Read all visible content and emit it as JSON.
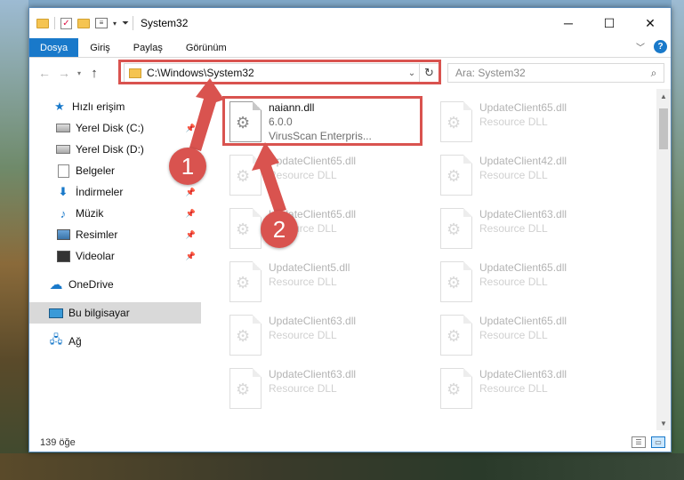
{
  "title": "System32",
  "ribbon": {
    "tabs": [
      "Dosya",
      "Giriş",
      "Paylaş",
      "Görünüm"
    ]
  },
  "address": {
    "path": "C:\\Windows\\System32",
    "search_placeholder": "Ara: System32"
  },
  "nav": {
    "items": [
      {
        "label": "Hızlı erişim",
        "icon": "star-icon"
      },
      {
        "label": "Yerel Disk (C:)",
        "icon": "drive-icon",
        "pinned": true
      },
      {
        "label": "Yerel Disk (D:)",
        "icon": "drive-icon",
        "pinned": true
      },
      {
        "label": "Belgeler",
        "icon": "documents-icon",
        "pinned": true
      },
      {
        "label": "İndirmeler",
        "icon": "downloads-icon",
        "pinned": true
      },
      {
        "label": "Müzik",
        "icon": "music-icon",
        "pinned": true
      },
      {
        "label": "Resimler",
        "icon": "pictures-icon",
        "pinned": true
      },
      {
        "label": "Videolar",
        "icon": "videos-icon",
        "pinned": true
      },
      {
        "label": "OneDrive",
        "icon": "cloud-icon"
      },
      {
        "label": "Bu bilgisayar",
        "icon": "computer-icon",
        "selected": true
      },
      {
        "label": "Ağ",
        "icon": "network-icon"
      }
    ]
  },
  "files": [
    {
      "name": "naiann.dll",
      "line1": "6.0.0",
      "line2": "VirusScan Enterpris...",
      "highlighted": true
    },
    {
      "name": "UpdateClient65.dll",
      "line1": "Resource DLL"
    },
    {
      "name": "UpdateClient65.dll",
      "line1": "Resource DLL"
    },
    {
      "name": "UpdateClient42.dll",
      "line1": "Resource DLL"
    },
    {
      "name": "UpdateClient65.dll",
      "line1": "Resource DLL"
    },
    {
      "name": "UpdateClient63.dll",
      "line1": "Resource DLL"
    },
    {
      "name": "UpdateClient5.dll",
      "line1": "Resource DLL"
    },
    {
      "name": "UpdateClient65.dll",
      "line1": "Resource DLL"
    },
    {
      "name": "UpdateClient63.dll",
      "line1": "Resource DLL"
    },
    {
      "name": "UpdateClient65.dll",
      "line1": "Resource DLL"
    },
    {
      "name": "UpdateClient63.dll",
      "line1": "Resource DLL"
    },
    {
      "name": "UpdateClient63.dll",
      "line1": "Resource DLL"
    }
  ],
  "status": {
    "item_count": "139 öğe"
  },
  "annotations": {
    "badge1": "1",
    "badge2": "2",
    "color": "#d9534f"
  },
  "colors": {
    "accent": "#1979ca",
    "highlight": "#d9534f"
  }
}
